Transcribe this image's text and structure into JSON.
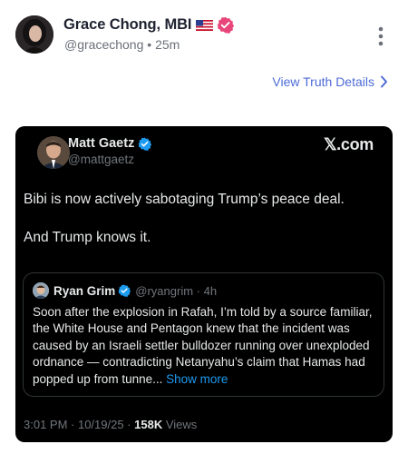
{
  "post": {
    "author_name": "Grace Chong, MBI",
    "handle": "@gracechong",
    "separator": "•",
    "time": "25m",
    "flag_icon": "us-flag-icon",
    "verified_icon": "verified-badge-icon"
  },
  "view_details": {
    "label": "View Truth Details"
  },
  "embedded_tweet": {
    "author_name": "Matt Gaetz",
    "handle": "@mattgaetz",
    "source_logo": "𝕏.com",
    "text_paragraphs": [
      "Bibi is now actively sabotaging Trump’s peace deal.",
      "And Trump knows it."
    ],
    "quote": {
      "author_name": "Ryan Grim",
      "handle": "@ryangrim",
      "meta_sep": "·",
      "time": "4h",
      "text": "Soon after the explosion in Rafah, I’m told by a source familiar, the White House and Pentagon knew that the incident was caused by an Israeli settler bulldozer running over unexploded ordnance — contradicting  Netanyahu’s claim that Hamas had popped up from tunne...",
      "show_more_label": " Show more"
    },
    "footer": {
      "timestamp": "3:01 PM · 10/19/25 · ",
      "views_count": "158K",
      "views_label": " Views"
    }
  },
  "colors": {
    "link_purple_blue": "#4d6bd6",
    "verified_pink": "#e8457a",
    "verified_blue": "#1d9bf0",
    "card_bg": "#000000"
  }
}
